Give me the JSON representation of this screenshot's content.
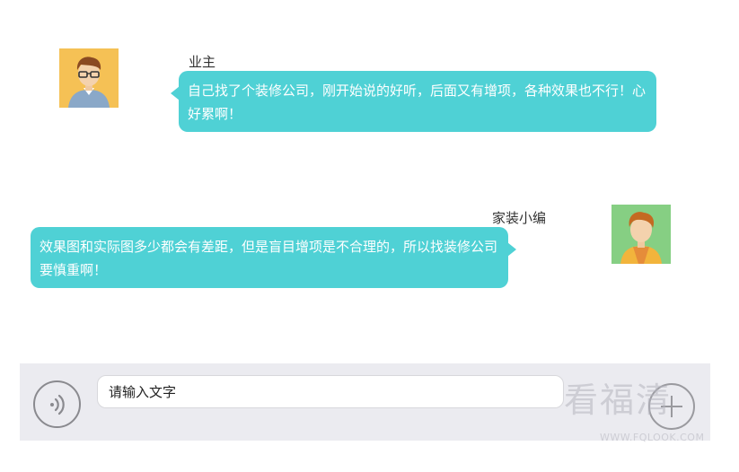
{
  "messages": [
    {
      "sender": "业主",
      "side": "left",
      "avatar": "man-glasses-avatar-icon",
      "text": "自己找了个装修公司，刚开始说的好听，后面又有增项，各种效果也不行！心好累啊！"
    },
    {
      "sender": "家装小编",
      "side": "right",
      "avatar": "young-man-avatar-icon",
      "text": "效果图和实际图多少都会有差距，但是盲目增项是不合理的，所以找装修公司要慎重啊！"
    }
  ],
  "input_bar": {
    "placeholder": "请输入文字",
    "voice_icon": "voice-icon",
    "plus_icon": "plus-icon"
  },
  "watermark": {
    "text": "看福清",
    "url": "WWW.FQLOOK.COM"
  },
  "colors": {
    "bubble": "#4fd1d5",
    "input_bar_bg": "#ebebf0",
    "avatar1_bg": "#f5c155",
    "avatar2_bg": "#86cf83"
  }
}
